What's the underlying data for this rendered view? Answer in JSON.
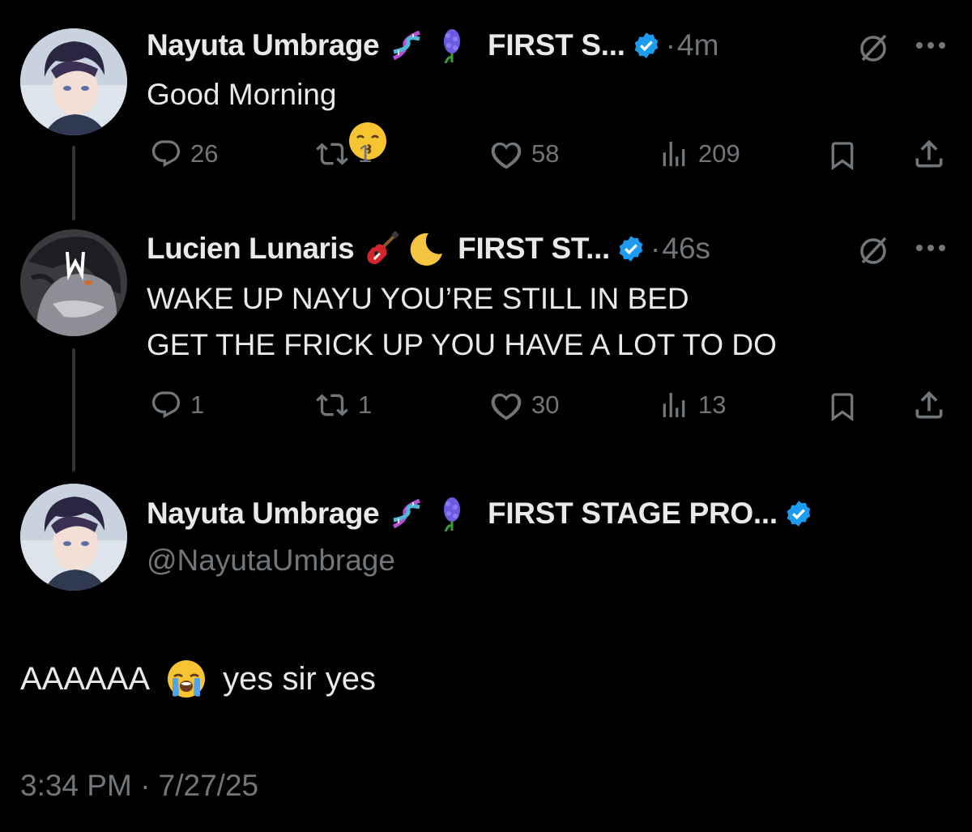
{
  "colors": {
    "background": "#000000",
    "text": "#e7e9ea",
    "muted": "#71767b",
    "verified": "#1d9bf0",
    "thread_line": "#333639"
  },
  "reply1": {
    "name": "Nayuta Umbrage",
    "org": "FIRST S...",
    "separator": "·",
    "time": "4m",
    "text": "Good Morning",
    "stats": {
      "replies": "26",
      "reposts": "1",
      "likes": "58",
      "views": "209"
    }
  },
  "reply2": {
    "name": "Lucien Lunaris",
    "org": "FIRST ST...",
    "separator": "·",
    "time": "46s",
    "text": "WAKE UP NAYU YOU’RE STILL IN BED\nGET THE FRICK UP YOU HAVE A LOT TO DO",
    "stats": {
      "replies": "1",
      "reposts": "1",
      "likes": "30",
      "views": "13"
    }
  },
  "main": {
    "name": "Nayuta Umbrage",
    "org": "FIRST STAGE PRO...",
    "handle": "@NayutaUmbrage",
    "text_before": "AAAAAA",
    "text_after": "yes sir yes",
    "timestamp": "3:34 PM · 7/27/25"
  }
}
